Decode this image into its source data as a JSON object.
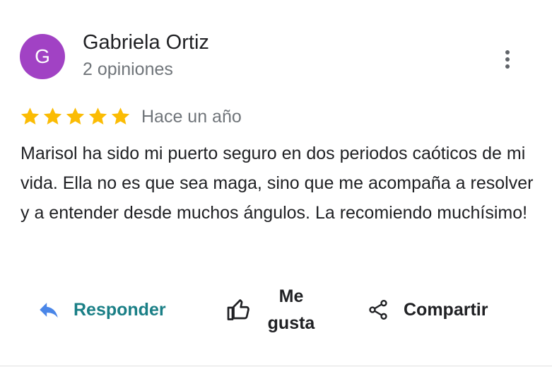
{
  "review": {
    "avatar_initial": "G",
    "avatar_color": "#a142c4",
    "author_name": "Gabriela Ortiz",
    "author_reviews": "2 opiniones",
    "rating": 5,
    "rating_max": 5,
    "star_color": "#fbbc04",
    "date": "Hace un año",
    "text": "Marisol ha sido mi puerto seguro en dos periodos caóticos de mi vida. Ella no es que sea maga, sino que me acompaña a resolver y a entender desde muchos ángulos. La recomiendo muchísimo!"
  },
  "actions": {
    "reply_label": "Responder",
    "like_label": "Me gusta",
    "share_label": "Compartir"
  },
  "icons": {
    "more": "more-vert-icon",
    "reply": "reply-icon",
    "like": "thumb-up-icon",
    "share": "share-icon",
    "star": "star-icon"
  },
  "colors": {
    "reply_accent": "#1a7f86",
    "reply_icon": "#4a86e8"
  }
}
